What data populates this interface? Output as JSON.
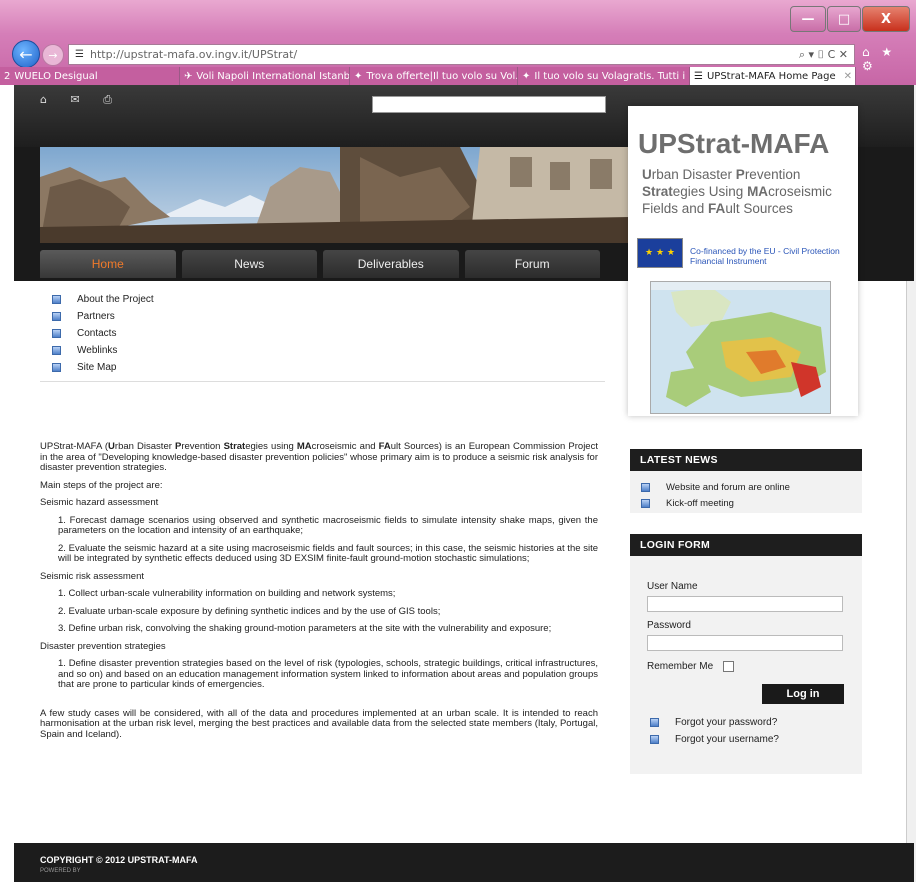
{
  "browser": {
    "url": "http://upstrat-mafa.ov.ingv.it/UPStrat/",
    "url_icon": "site-favicon",
    "tools": "⌕ ▾ ⌷ C ✕",
    "right_icons": "⌂ ★ ⚙",
    "window_buttons": [
      "—",
      "□",
      "X"
    ],
    "tabs": [
      {
        "label": "WUELO Desigual",
        "icon": "2"
      },
      {
        "label": "Voli Napoli International Istanb...",
        "icon": "✈"
      },
      {
        "label": "Trova offerte|Il tuo volo su Vol...",
        "icon": "✦"
      },
      {
        "label": "Il tuo volo su Volagratis. Tutti i ...",
        "icon": "✦"
      },
      {
        "label": "UPStrat-MAFA Home Page",
        "icon": "☰",
        "active": true,
        "close": "✕"
      }
    ]
  },
  "site": {
    "top_icons": "⌂ ✉ ⎙",
    "menu": [
      {
        "label": "Home",
        "active": true
      },
      {
        "label": "News"
      },
      {
        "label": "Deliverables"
      },
      {
        "label": "Forum"
      }
    ],
    "submenu": [
      "About the Project",
      "Partners",
      "Contacts",
      "Weblinks",
      "Site Map"
    ],
    "logo": {
      "title": "UPStrat-MAFA",
      "sub_line1_a": "U",
      "sub_line1_b": "rban Disaster ",
      "sub_line1_c": "P",
      "sub_line1_d": "revention",
      "sub_line2_a": "Strat",
      "sub_line2_b": "egies Using ",
      "sub_line2_c": "MA",
      "sub_line2_d": "croseismic",
      "sub_line3_a": "Fields and ",
      "sub_line3_b": "FA",
      "sub_line3_c": "ult Sources",
      "eu_text": "Co-financed by the EU - Civil Protection Financial Instrument",
      "eu_stars": "★ ★ ★"
    },
    "article": {
      "intro_a": "UPStrat-MAFA (",
      "intro_b": "U",
      "intro_c": "rban Disaster ",
      "intro_d": "P",
      "intro_e": "revention ",
      "intro_f": "Strat",
      "intro_g": "egies using ",
      "intro_h": "MA",
      "intro_i": "croseismic and ",
      "intro_j": "FA",
      "intro_k": "ult Sources) is an European Commission Project in the area of \"Developing knowledge-based disaster prevention policies\" whose primary aim is to produce a seismic risk analysis for disaster prevention strategies.",
      "main_steps": "Main steps of the project are:",
      "h1": "Seismic hazard assessment",
      "s1": "1.  Forecast damage scenarios using observed and synthetic macroseismic fields to simulate intensity shake maps, given the parameters on the location and intensity of an earthquake;",
      "s2": "2. Evaluate the seismic hazard at a site using macroseismic fields and fault sources; in this case, the seismic histories at the site will be integrated by synthetic effects deduced using 3D EXSIM finite-fault ground-motion stochastic simulations;",
      "h2": "Seismic risk assessment",
      "s3": "1.  Collect urban-scale vulnerability information on building and network systems;",
      "s4": "2.  Evaluate urban-scale exposure by defining synthetic indices and by the use of GIS tools;",
      "s5": "3.  Define urban risk, convolving the shaking ground-motion parameters at the site with the vulnerability and exposure;",
      "h3": "Disaster prevention strategies",
      "s6": "1.  Define disaster prevention strategies based on the level of risk (typologies, schools, strategic buildings, critical infrastructures, and so on) and based on an education management information system linked to information about areas and population groups that are prone to particular kinds of emergencies.",
      "closing": "A few study cases will be considered, with all of the data and procedures implemented at an urban scale. It is intended to reach harmonisation at the urban risk level, merging the best practices and available data from the selected state members (Italy, Portugal, Spain and Iceland)."
    },
    "latest_news": {
      "title": "LATEST NEWS",
      "items": [
        "Website and forum are online",
        "Kick-off meeting"
      ]
    },
    "login": {
      "title": "LOGIN FORM",
      "username_label": "User Name",
      "password_label": "Password",
      "remember_label": "Remember Me",
      "button": "Log in",
      "forgot_password": "Forgot your password?",
      "forgot_username": "Forgot your username?"
    },
    "footer": {
      "copyright": "COPYRIGHT © 2012 UPSTRAT-MAFA",
      "powered": "POWERED BY"
    }
  },
  "colors": {
    "accent_orange": "#f07a2a",
    "chrome_pink": "#d57eb8",
    "logo_grey": "#6e6e6e",
    "eu_blue": "#1b3f9c"
  }
}
